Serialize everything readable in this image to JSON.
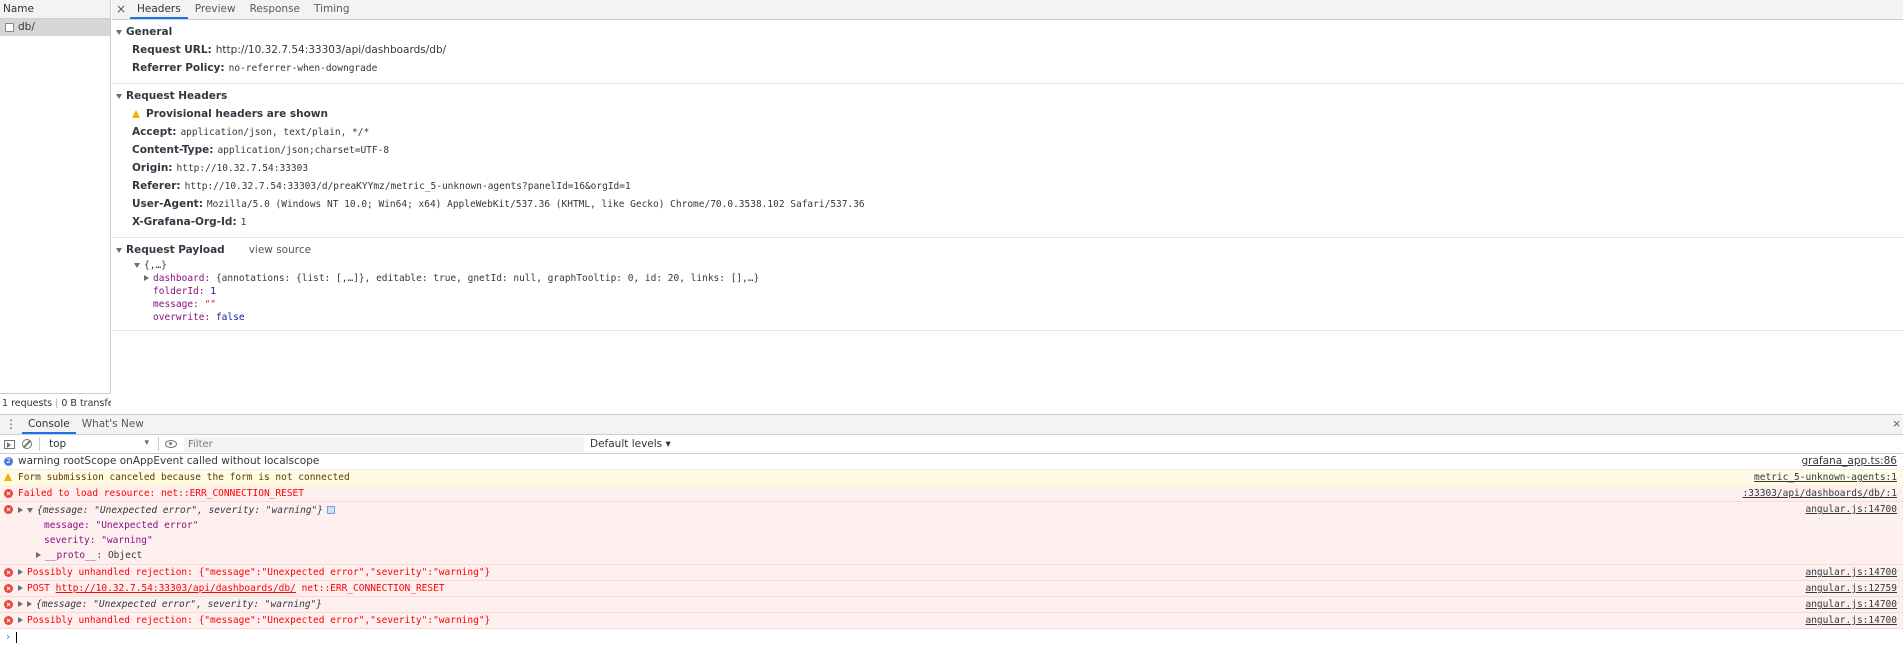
{
  "network": {
    "name_header": "Name",
    "request_name": "db/",
    "footer": {
      "requests": "1 requests",
      "transferred": "0 B transfe..."
    }
  },
  "tabs": [
    "Headers",
    "Preview",
    "Response",
    "Timing"
  ],
  "general": {
    "title": "General",
    "request_url_label": "Request URL:",
    "request_url": "http://10.32.7.54:33303/api/dashboards/db/",
    "referrer_policy_label": "Referrer Policy:",
    "referrer_policy": "no-referrer-when-downgrade"
  },
  "request_headers": {
    "title": "Request Headers",
    "provisional": "Provisional headers are shown",
    "items": [
      {
        "key": "Accept:",
        "value": "application/json, text/plain, */*"
      },
      {
        "key": "Content-Type:",
        "value": "application/json;charset=UTF-8"
      },
      {
        "key": "Origin:",
        "value": "http://10.32.7.54:33303"
      },
      {
        "key": "Referer:",
        "value": "http://10.32.7.54:33303/d/preaKYYmz/metric_5-unknown-agents?panelId=16&orgId=1"
      },
      {
        "key": "User-Agent:",
        "value": "Mozilla/5.0 (Windows NT 10.0; Win64; x64) AppleWebKit/537.36 (KHTML, like Gecko) Chrome/70.0.3538.102 Safari/537.36"
      },
      {
        "key": "X-Grafana-Org-Id:",
        "value": "1"
      }
    ]
  },
  "payload": {
    "title": "Request Payload",
    "view_source": "view source",
    "root": "{,…}",
    "dashboard_key": "dashboard:",
    "dashboard_value": "{annotations: {list: [,…]}, editable: true, gnetId: null, graphTooltip: 0, id: 20, links: [],…}",
    "folderId_key": "folderId:",
    "folderId_value": "1",
    "message_key": "message:",
    "message_value": "\"\"",
    "overwrite_key": "overwrite:",
    "overwrite_value": "false"
  },
  "drawer": {
    "tabs": [
      "Console",
      "What's New"
    ],
    "context": "top",
    "filter_placeholder": "Filter",
    "levels": "Default levels ▾"
  },
  "console": {
    "m1_count": "2",
    "m1_text": "warning rootScope onAppEvent called without localscope",
    "m1_src": "grafana_app.ts:86",
    "m2_text": "Form submission canceled because the form is not connected",
    "m2_src": "metric_5-unknown-agents:1",
    "m3_text": "Failed to load resource: net::ERR_CONNECTION_RESET",
    "m3_src": ":33303/api/dashboards/db/:1",
    "m4_text": "{message: \"Unexpected error\", severity: \"warning\"}",
    "m4_src": "angular.js:14700",
    "m4_line1": "message: \"Unexpected error\"",
    "m4_line2": "severity: \"warning\"",
    "m4_line3_key": "__proto__:",
    "m4_line3_val": "Object",
    "m5_text": "Possibly unhandled rejection: {\"message\":\"Unexpected error\",\"severity\":\"warning\"}",
    "m5_src": "angular.js:14700",
    "m6_prefix": "POST",
    "m6_url": "http://10.32.7.54:33303/api/dashboards/db/",
    "m6_suffix": "net::ERR_CONNECTION_RESET",
    "m6_src": "angular.js:12759",
    "m7_text": "{message: \"Unexpected error\", severity: \"warning\"}",
    "m7_src": "angular.js:14700",
    "m8_text": "Possibly unhandled rejection: {\"message\":\"Unexpected error\",\"severity\":\"warning\"}",
    "m8_src": "angular.js:14700"
  }
}
